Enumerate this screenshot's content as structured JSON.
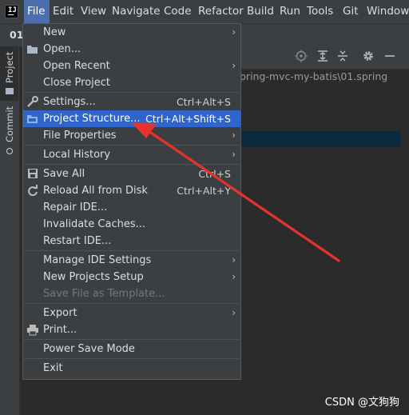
{
  "menubar": {
    "items": [
      "File",
      "Edit",
      "View",
      "Navigate",
      "Code",
      "Refactor",
      "Build",
      "Run",
      "Tools",
      "Git",
      "Window"
    ]
  },
  "tab": {
    "label": "01."
  },
  "toolstrip": {
    "project": "Project",
    "commit": "Commit"
  },
  "project_panel": {
    "path_text": "pring-mvc-my-batis\\01.spring",
    "toolbar_icons": [
      "locate-icon",
      "expand-all-icon",
      "collapse-all-icon",
      "gear-icon",
      "minimize-icon"
    ]
  },
  "file_menu": {
    "new": "New",
    "open": "Open...",
    "open_recent": "Open Recent",
    "close_project": "Close Project",
    "settings": "Settings...",
    "settings_shortcut": "Ctrl+Alt+S",
    "project_structure": "Project Structure...",
    "project_structure_shortcut": "Ctrl+Alt+Shift+S",
    "file_properties": "File Properties",
    "local_history": "Local History",
    "save_all": "Save All",
    "save_all_shortcut": "Ctrl+S",
    "reload": "Reload All from Disk",
    "reload_shortcut": "Ctrl+Alt+Y",
    "repair": "Repair IDE...",
    "invalidate": "Invalidate Caches...",
    "restart": "Restart IDE...",
    "manage_settings": "Manage IDE Settings",
    "new_projects_setup": "New Projects Setup",
    "save_template": "Save File as Template...",
    "export": "Export",
    "print": "Print...",
    "power_save": "Power Save Mode",
    "exit": "Exit"
  },
  "annotation": {
    "color": "#e8322d"
  },
  "watermark": "CSDN @文狗狗"
}
